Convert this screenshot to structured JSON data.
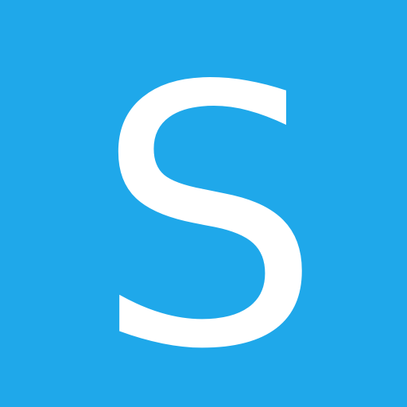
{
  "app_icon": {
    "letter": "S",
    "background_color": "#1fa8ea",
    "letter_color": "#ffffff"
  }
}
